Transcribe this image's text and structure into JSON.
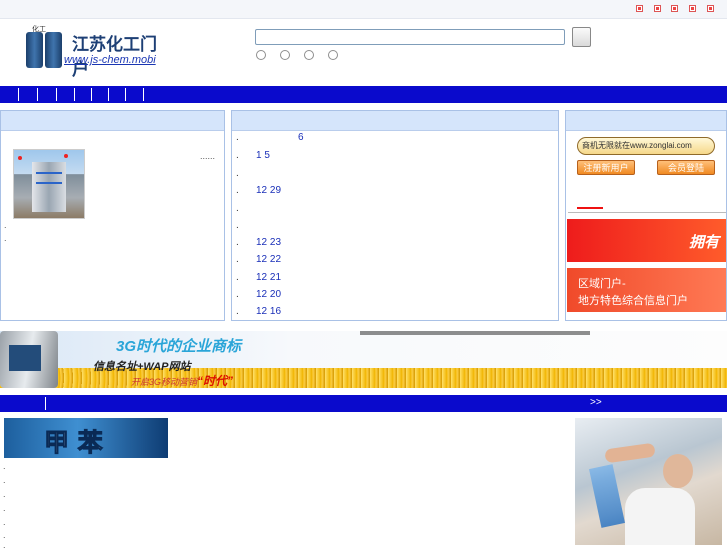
{
  "topbar": {
    "icons": [
      "close-icon",
      "close-icon",
      "close-icon",
      "close-icon",
      "close-icon"
    ]
  },
  "logo": {
    "title": "江苏化工门户",
    "url_text": "www.js-chem.mobi",
    "drum_label": "化工"
  },
  "search": {
    "value": "",
    "radios": 4
  },
  "nav": {
    "separators": 8
  },
  "left_panel": {
    "more": "......",
    "dots": [
      ".",
      "."
    ]
  },
  "news": [
    {
      "bullet": ".",
      "date": "6"
    },
    {
      "bullet": ".",
      "date": "1 5"
    },
    {
      "bullet": ".",
      "date": ""
    },
    {
      "bullet": ".",
      "date": "12 29"
    },
    {
      "bullet": ".",
      "date": ""
    },
    {
      "bullet": ".",
      "date": ""
    },
    {
      "bullet": ".",
      "date": "12 23"
    },
    {
      "bullet": ".",
      "date": "12 22"
    },
    {
      "bullet": ".",
      "date": "12 21"
    },
    {
      "bullet": ".",
      "date": "12 20"
    },
    {
      "bullet": ".",
      "date": "12 16"
    }
  ],
  "right_panel": {
    "zonglai": "商机无限就在www.zonglai.com",
    "register": "注册新用户",
    "login": "会员登陆",
    "ad1": "拥有",
    "ad2_line1": "区域门户-",
    "ad2_line2": "地方特色综合信息门户"
  },
  "banner": {
    "line1": "3G时代的企业商标",
    "line2": "信息名址+WAP网站",
    "line3_a": "开启3G移动营销",
    "line3_b": "“时代”"
  },
  "nav2": {
    "more": ">>"
  },
  "bottom": {
    "brand": "甲 苯",
    "dots": [
      ".",
      ".",
      ".",
      ".",
      ".",
      ".",
      "."
    ]
  },
  "colors": {
    "nav": "#0a0acc",
    "panel_head": "#d5e5fb",
    "panel_border": "#a9c1e6",
    "link": "#1a2fb8"
  }
}
